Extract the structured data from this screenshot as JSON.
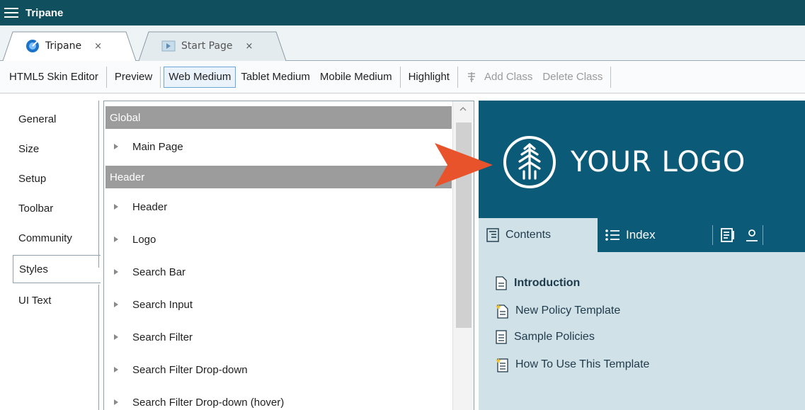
{
  "window": {
    "title": "Tripane"
  },
  "tabs": [
    {
      "label": "Tripane",
      "close": "×"
    },
    {
      "label": "Start Page",
      "close": "×"
    }
  ],
  "toolbar": {
    "skin_editor": "HTML5 Skin Editor",
    "preview": "Preview",
    "web_medium": "Web Medium",
    "tablet_medium": "Tablet Medium",
    "mobile_medium": "Mobile Medium",
    "highlight": "Highlight",
    "add_class": "Add Class",
    "delete_class": "Delete Class"
  },
  "categories": [
    "General",
    "Size",
    "Setup",
    "Toolbar",
    "Community",
    "Styles",
    "UI Text"
  ],
  "selected_category": "Styles",
  "styles": {
    "global_header": "Global",
    "main_page": "Main Page",
    "header_group": "Header",
    "items": [
      "Header",
      "Logo",
      "Search Bar",
      "Search Input",
      "Search Filter",
      "Search Filter Drop-down",
      "Search Filter Drop-down (hover)"
    ]
  },
  "preview": {
    "logo_text": "YOUR LOGO",
    "tab_contents": "Contents",
    "tab_index": "Index",
    "toc": [
      "Introduction",
      "New Policy Template",
      "Sample Policies",
      "How To Use This Template"
    ]
  },
  "colors": {
    "titlebar": "#0f4f5e",
    "preview_header": "#0b5a78",
    "preview_body": "#d0e1e8",
    "arrow": "#e8532b",
    "group_header": "#9c9c9c"
  }
}
